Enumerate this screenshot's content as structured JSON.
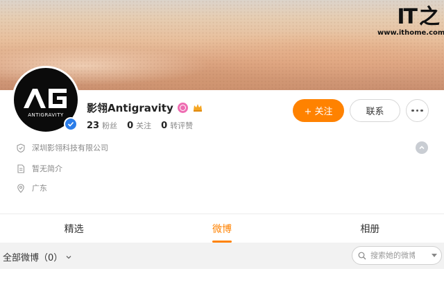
{
  "watermark": {
    "logo_text": "IT之家",
    "url": "www.ithome.com"
  },
  "profile": {
    "avatar_text": "ANTIGRAVITY",
    "name": "影翎Antigravity",
    "followers_count": "23",
    "followers_label": "粉丝",
    "following_count": "0",
    "following_label": "关注",
    "reposts_count": "0",
    "reposts_label": "转评赞"
  },
  "actions": {
    "follow_label": "+ 关注",
    "contact_label": "联系"
  },
  "info": {
    "company": "深圳影翎科技有限公司",
    "intro": "暂无简介",
    "location": "广东"
  },
  "tabs": [
    {
      "label": "精选"
    },
    {
      "label": "微博"
    },
    {
      "label": "相册"
    }
  ],
  "filter": {
    "label": "全部微博（0）",
    "search_placeholder": "搜索她的微博"
  },
  "colors": {
    "accent": "#ff8200",
    "verified": "#2b7de9",
    "badge": "#ee6db2"
  }
}
